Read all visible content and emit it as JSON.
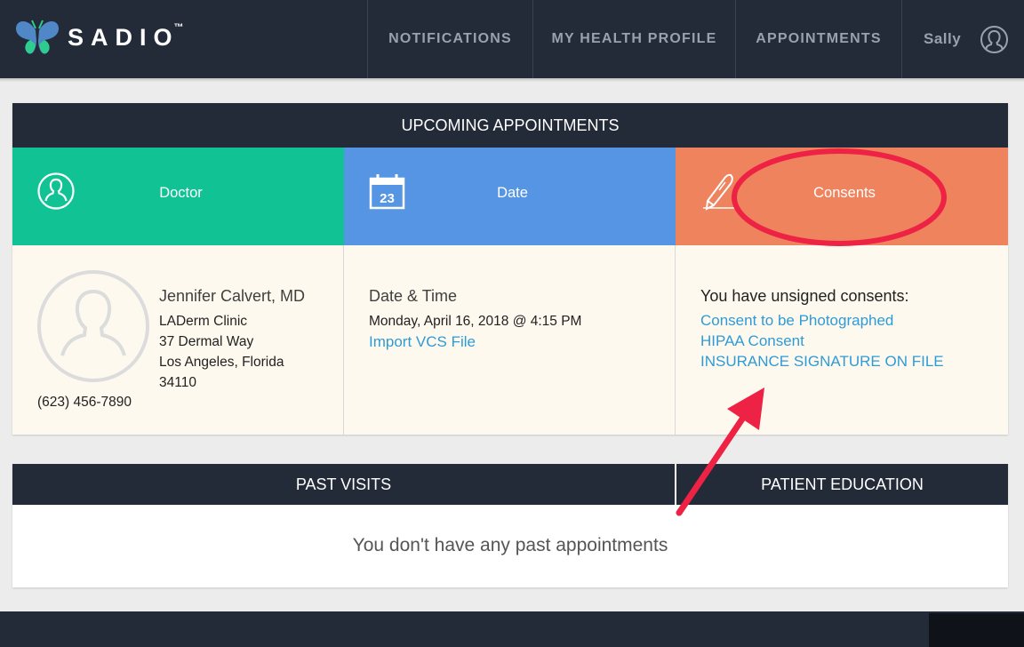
{
  "header": {
    "brand": "SADIO",
    "brand_tm": "™",
    "nav": {
      "notifications": "NOTIFICATIONS",
      "health_profile": "MY HEALTH PROFILE",
      "appointments": "APPOINTMENTS",
      "user": "Sally"
    }
  },
  "upcoming": {
    "title": "UPCOMING APPOINTMENTS",
    "columns": {
      "doctor": "Doctor",
      "date": "Date",
      "date_icon_day": "23",
      "consents": "Consents"
    },
    "doctor": {
      "name": "Jennifer Calvert, MD",
      "clinic": "LADerm Clinic",
      "street": "37 Dermal Way",
      "city": "Los Angeles, Florida",
      "zip": "34110",
      "phone": "(623) 456-7890"
    },
    "datetime": {
      "title": "Date & Time",
      "value": "Monday, April 16, 2018 @ 4:15 PM",
      "import_link": "Import VCS File"
    },
    "consents": {
      "title": "You have unsigned consents:",
      "items": [
        "Consent to be Photographed",
        "HIPAA Consent",
        "INSURANCE SIGNATURE ON FILE"
      ]
    }
  },
  "past": {
    "tabs": {
      "past_visits": "PAST VISITS",
      "patient_education": "PATIENT EDUCATION"
    },
    "empty_message": "You don't have any past appointments"
  },
  "colors": {
    "navy": "#232a38",
    "doctor_green": "#11c394",
    "date_blue": "#5695e3",
    "consents_orange": "#ef835e",
    "link_blue": "#2f9bd6",
    "annotation_red": "#ee2244"
  },
  "icons": {
    "logo": "butterfly-logo-icon",
    "user": "user-avatar-icon",
    "doctor": "person-icon",
    "date": "calendar-icon",
    "consents": "pen-icon",
    "doctor_photo": "avatar-placeholder-icon"
  }
}
